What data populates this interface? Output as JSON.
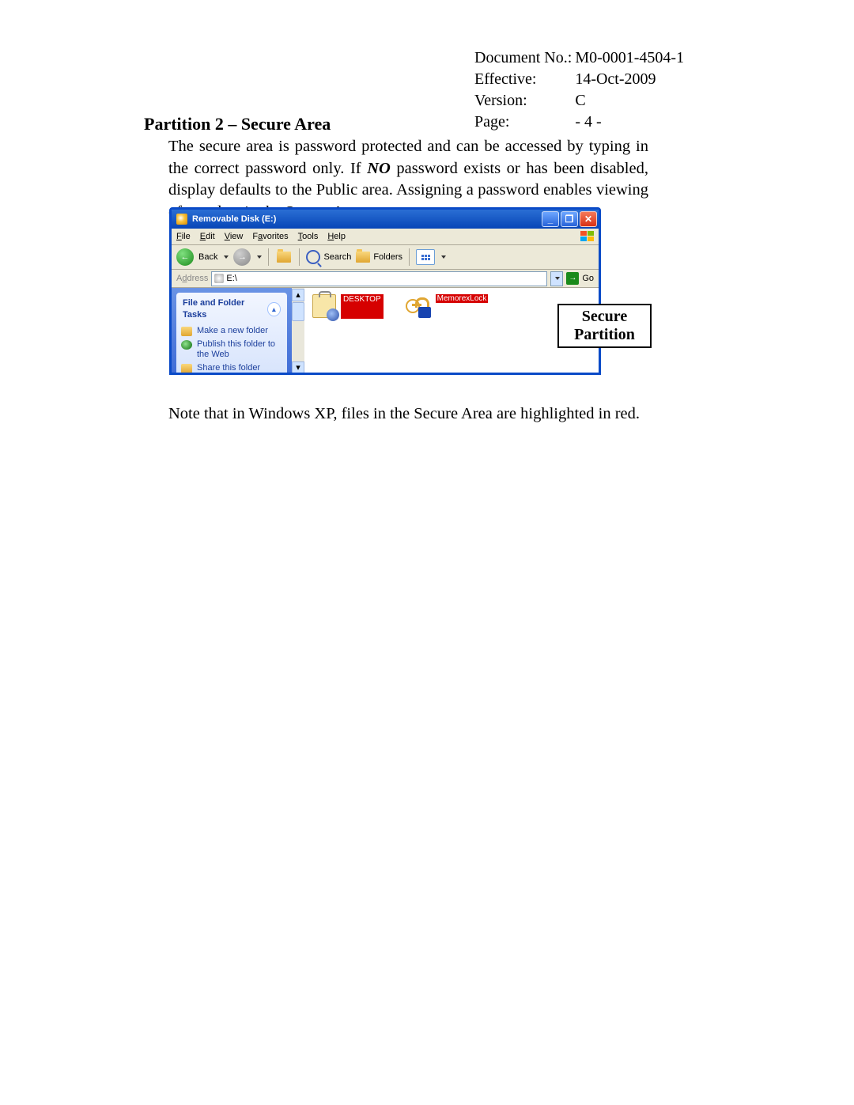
{
  "meta": {
    "doc_no_label": "Document No.:",
    "doc_no": "M0-0001-4504-1",
    "effective_label": "Effective:",
    "effective": "14-Oct-2009",
    "version_label": "Version:",
    "version": "C",
    "page_label": "Page:",
    "page": "- 4 -"
  },
  "heading": "Partition 2 – Secure Area",
  "para": {
    "p1": "The secure area is password protected and can be accessed by typing in the correct password only. If ",
    "no": "NO",
    "p2": " password exists or has been disabled, display defaults to the Public area.   Assigning a password enables viewing of any data in the Secure Area."
  },
  "note": "Note that in Windows XP, files in the Secure Area are highlighted in red.",
  "callout": {
    "l1": "Secure",
    "l2": "Partition"
  },
  "explorer": {
    "title": "Removable Disk (E:)",
    "menu": {
      "file": "File",
      "edit": "Edit",
      "view": "View",
      "favorites": "Favorites",
      "tools": "Tools",
      "help": "Help"
    },
    "toolbar": {
      "back": "Back",
      "search": "Search",
      "folders": "Folders"
    },
    "address": {
      "label": "Address",
      "value": "E:\\",
      "go": "Go"
    },
    "tasks": {
      "heading": "File and Folder Tasks",
      "items": [
        "Make a new folder",
        "Publish this folder to the Web",
        "Share this folder"
      ]
    },
    "files": {
      "desktop": "DESKTOP",
      "lock": "MemorexLock"
    }
  }
}
